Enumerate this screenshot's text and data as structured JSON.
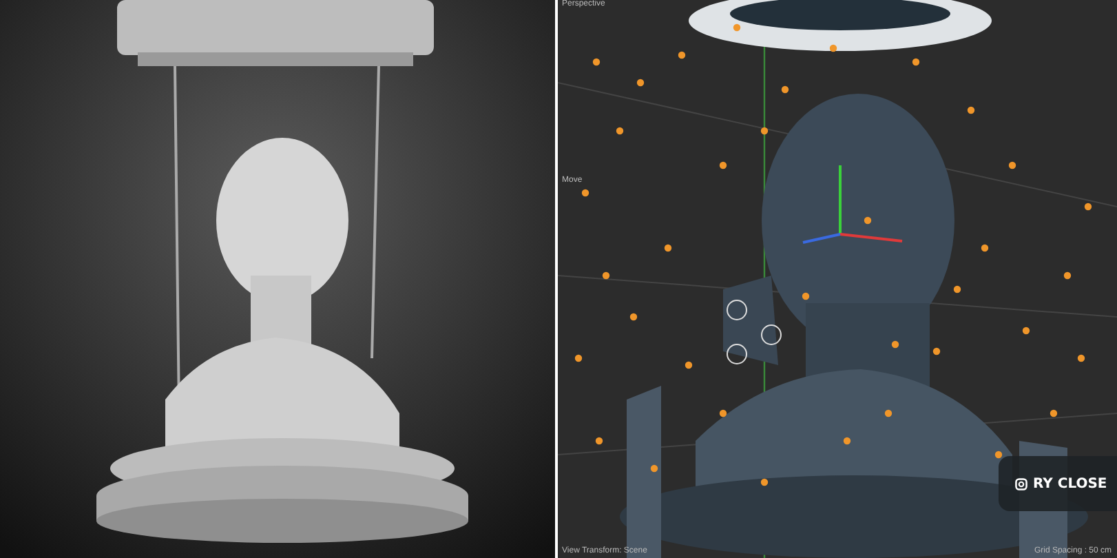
{
  "viewport": {
    "view_label": "Perspective",
    "tool_label": "Move",
    "transform_label": "View Transform: Scene",
    "grid_label": "Grid Spacing : 50 cm"
  },
  "close_button": {
    "label": "RY CLOSE"
  }
}
